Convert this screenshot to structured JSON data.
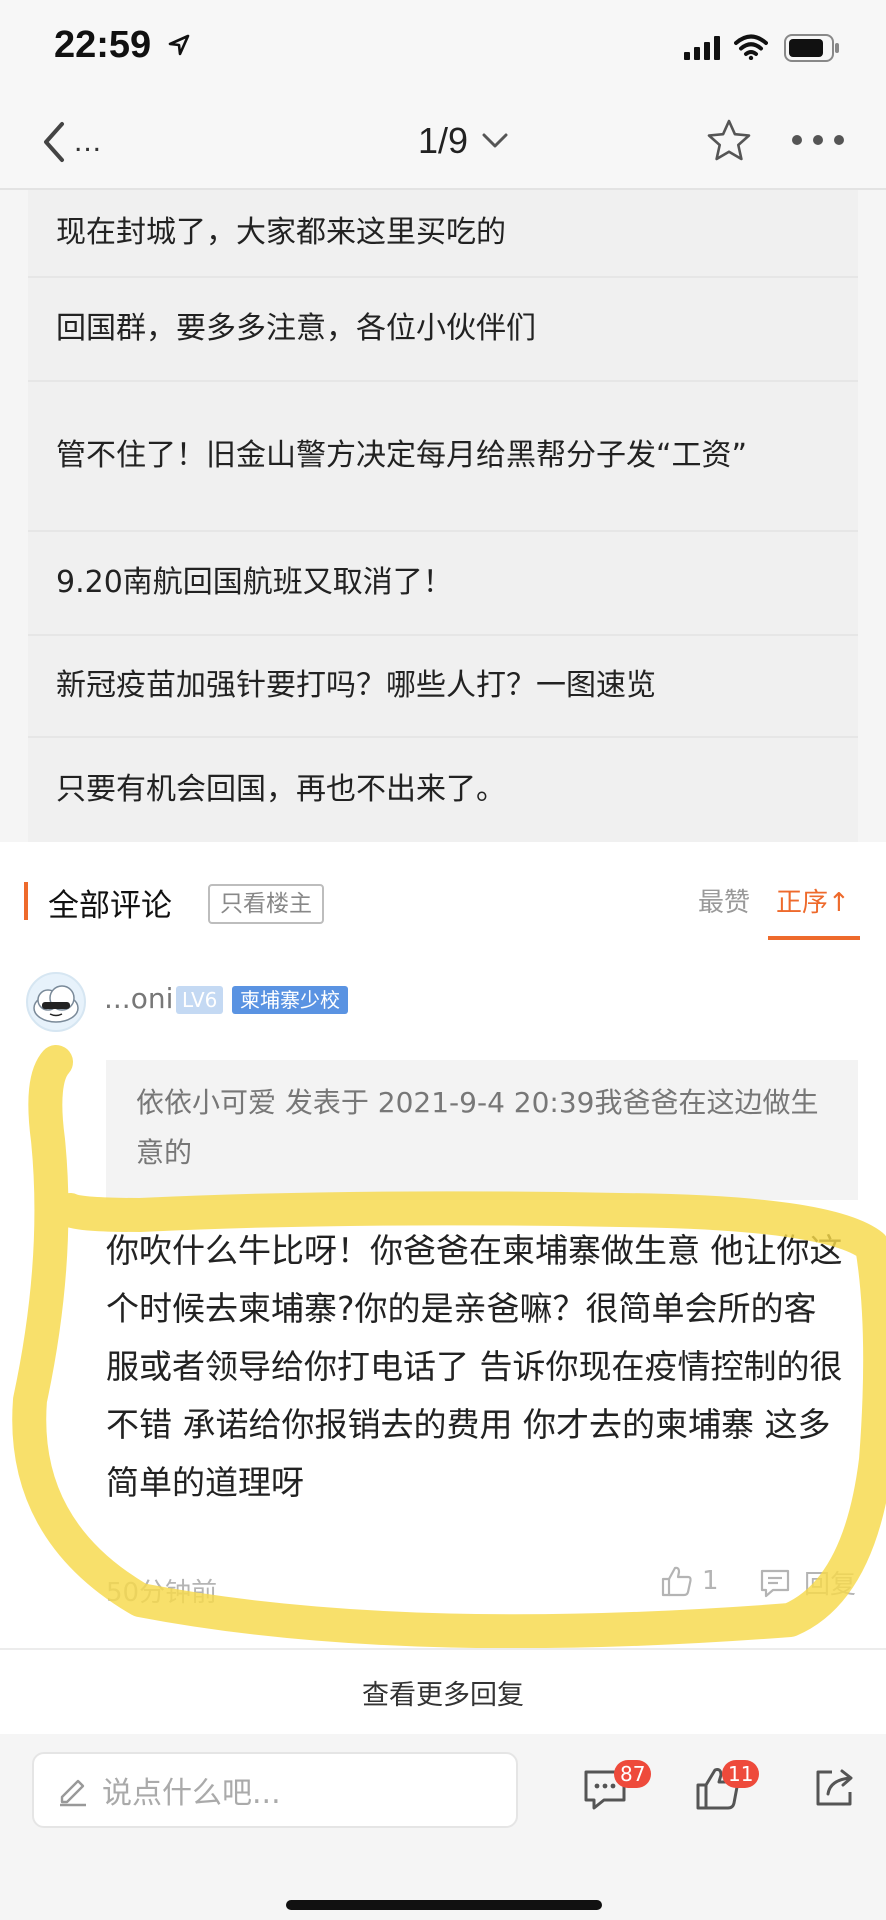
{
  "status_bar": {
    "time": "22:59"
  },
  "nav": {
    "page_indicator": "1/9",
    "back_ellipsis": "..."
  },
  "related": {
    "items": [
      "现在封城了，大家都来这里买吃的",
      "回国群，要多多注意，各位小伙伴们",
      "管不住了！旧金山警方决定每月给黑帮分子发“工资”",
      "9.20南航回国航班又取消了！",
      "新冠疫苗加强针要打吗？哪些人打？一图速览",
      "只要有机会回国，再也不出来了。"
    ]
  },
  "comments": {
    "header": "全部评论",
    "op_only": "只看楼主",
    "sort_popular": "最赞",
    "sort_order": "正序↑",
    "items": [
      {
        "username": "...oni",
        "level": "LV6",
        "tag": "柬埔寨少校",
        "quote": "依依小可爱 发表于 2021-9-4 20:39我爸爸在这边做生意的",
        "text": "你吹什么牛比呀！你爸爸在柬埔寨做生意 他让你这个时候去柬埔寨?你的是亲爸嘛？很简单会所的客服或者领导给你打电话了 告诉你现在疫情控制的很不错 承诺给你报销去的费用 你才去的柬埔寨 这多简单的道理呀",
        "time": "50分钟前",
        "likes": "1",
        "reply_label": "回复"
      }
    ],
    "more_replies": "查看更多回复"
  },
  "bottom_bar": {
    "input_placeholder": "说点什么吧...",
    "comment_count": "87",
    "like_count": "11"
  },
  "colors": {
    "accent": "#ee6a2c",
    "highlight": "#f7d94a",
    "badge": "#ee4a3b",
    "level_badge": "#c4d9f3",
    "tag_badge": "#5a93e2"
  },
  "icons": [
    "location-arrow-icon",
    "signal-icon",
    "wifi-icon",
    "battery-icon",
    "back-chevron-icon",
    "chevron-down-icon",
    "star-icon",
    "more-icon",
    "thumbs-up-icon",
    "reply-icon",
    "pen-icon",
    "comment-bubble-icon",
    "share-icon"
  ]
}
